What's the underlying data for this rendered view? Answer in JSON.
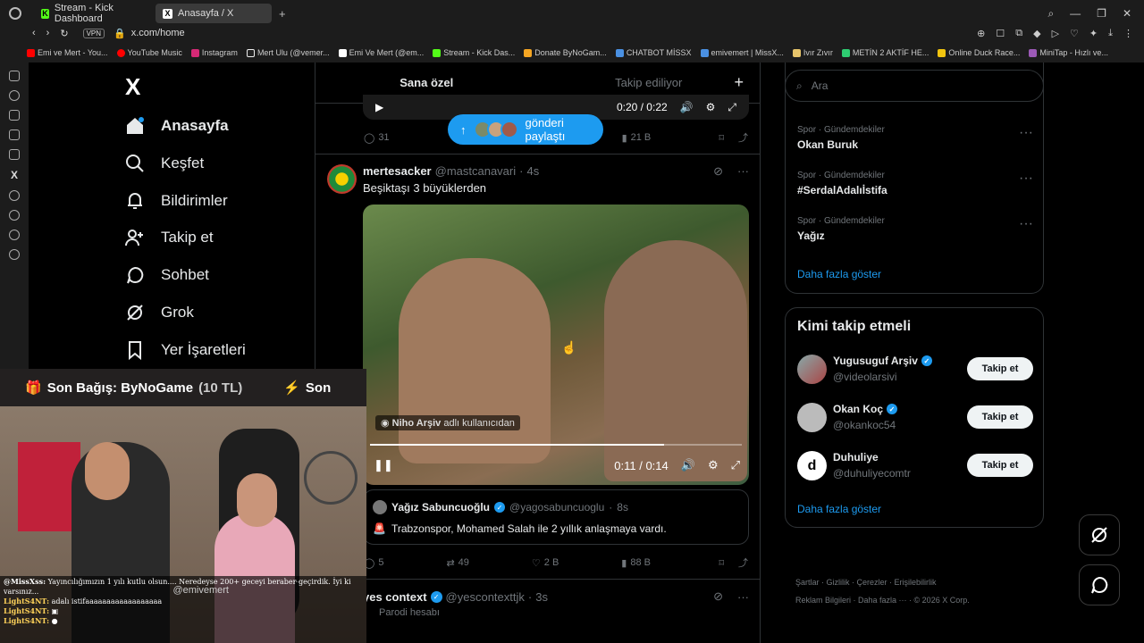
{
  "browser": {
    "tabs": [
      {
        "label": "Stream - Kick Dashboard",
        "icon": "kick-icon"
      },
      {
        "label": "Anasayfa / X",
        "icon": "x-icon"
      }
    ],
    "new_tab": "+",
    "vpn": "VPN",
    "url": "x.com/home",
    "bookmarks": [
      "Emi ve Mert - You...",
      "YouTube Music",
      "Instagram",
      "Mert Ulu (@vemer...",
      "Emi Ve Mert (@em...",
      "Stream - Kick Das...",
      "Donate ByNoGam...",
      "CHATBOT MİSSX",
      "emivemert | MissX...",
      "Ivır Zıvır",
      "METİN 2 AKTİF HE...",
      "Online Duck Race...",
      "MiniTap - Hızlı ve..."
    ]
  },
  "nav": {
    "logo": "X",
    "items": [
      {
        "label": "Anasayfa",
        "icon": "home-icon"
      },
      {
        "label": "Keşfet",
        "icon": "search-icon"
      },
      {
        "label": "Bildirimler",
        "icon": "bell-icon"
      },
      {
        "label": "Takip et",
        "icon": "person-add-icon"
      },
      {
        "label": "Sohbet",
        "icon": "chat-icon"
      },
      {
        "label": "Grok",
        "icon": "grok-icon"
      },
      {
        "label": "Yer İşaretleri",
        "icon": "bookmark-icon"
      }
    ]
  },
  "timeline": {
    "tabs": [
      "Sana özel",
      "Takip ediliyor"
    ],
    "add_tab": "+",
    "prev_video_time": "0:20 / 0:22",
    "new_posts_pill": "gönderi paylaştı",
    "prev_actions": {
      "replies": "31",
      "views": "21 B"
    },
    "tweet": {
      "name": "mertesacker",
      "handle": "@mastcanavari",
      "time": "4s",
      "text": "Beşiktaşı 3 büyüklerden",
      "video_source_name": "Niho Arşiv",
      "video_source_suffix": "adlı kullanıcıdan",
      "video_time": "0:11 / 0:14",
      "video_progress": 0.79,
      "quote": {
        "name": "Yağız Sabuncuoğlu",
        "handle": "@yagosabuncuoglu",
        "time": "8s",
        "text": "Trabzonspor, Mohamed Salah ile 2 yıllık anlaşmaya vardı."
      },
      "actions": {
        "replies": "5",
        "retweets": "49",
        "likes": "2 B",
        "views": "88 B"
      }
    },
    "next_tweet": {
      "name": "yes context",
      "handle": "@yescontexttjk",
      "time": "3s",
      "subtitle": "Parodi hesabı"
    }
  },
  "right": {
    "search_placeholder": "Ara",
    "trends": [
      {
        "meta": "Spor · Gündemdekiler",
        "name": "Okan Buruk"
      },
      {
        "meta": "Spor · Gündemdekiler",
        "name": "#SerdalAdalıİstifa"
      },
      {
        "meta": "Spor · Gündemdekiler",
        "name": "Yağız"
      }
    ],
    "show_more": "Daha fazla göster",
    "who_to_follow_title": "Kimi takip etmeli",
    "follow_suggestions": [
      {
        "name": "Yugusuguf Arşiv",
        "handle": "@videolarsivi",
        "verified": true,
        "button": "Takip et"
      },
      {
        "name": "Okan Koç",
        "handle": "@okankoc54",
        "verified": true,
        "button": "Takip et"
      },
      {
        "name": "Duhuliye",
        "handle": "@duhuliyecomtr",
        "verified": false,
        "button": "Takip et"
      }
    ],
    "show_more_2": "Daha fazla göster",
    "footer": [
      "Şartlar",
      "Gizlilik",
      "Çerezler",
      "Erişilebilirlik",
      "Reklam Bilgileri",
      "Daha fazla ···",
      "© 2026 X Corp."
    ]
  },
  "stream": {
    "banner_label": "Son Bağış: ByNoGame",
    "banner_amount": "(10 TL)",
    "banner_next": "Son",
    "watermark": "@emivemert",
    "chat": [
      {
        "user": "@MissXss:",
        "text": "Yayıncılığımızın 1 yılı kutlu olsun.... Neredeyse 200+ geceyi beraber geçirdik. İyi ki varsınız..."
      },
      {
        "user": "LightS4NT:",
        "text": "adalı istifaaaaaaaaaaaaaaaaaa"
      },
      {
        "user": "LightS4NT:",
        "text": ""
      },
      {
        "user": "LightS4NT:",
        "text": ""
      }
    ]
  },
  "colors": {
    "accent": "#1d9bf0",
    "bg": "#000000",
    "border": "#2f3336",
    "muted": "#71767b"
  }
}
